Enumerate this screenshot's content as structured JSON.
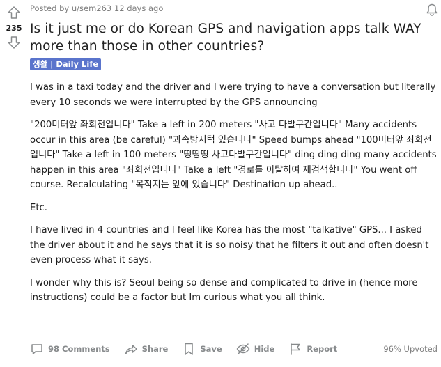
{
  "vote": {
    "count": "235"
  },
  "post": {
    "meta_prefix": "Posted by",
    "author": "u/sem263",
    "age": "12 days ago",
    "title": "Is it just me or do Korean GPS and navigation apps talk WAY more than those in other countries?",
    "flair": "생활 | Daily Life",
    "paragraphs": [
      "I was in a taxi today and the driver and I were trying to have a conversation but literally every 10 seconds we were interrupted by the GPS announcing",
      "\"200미터앞 좌회전입니다\" Take a left in 200 meters \"사고 다발구간입니다\" Many accidents occur in this area (be careful) \"과속방지턱 있습니다\" Speed bumps ahead \"100미터앞 좌회전입니다\" Take a left in 100 meters \"띵띵띵 사고다발구간입니다\" ding ding ding many accidents happen in this area \"좌회전입니다\" Take a left \"경로를 이탈하여 재검색합니다\" You went off course. Recalculating \"목적지는 앞에 있습니다\" Destination up ahead..",
      "Etc.",
      "I have lived in 4 countries and I feel like Korea has the most \"talkative\" GPS... I asked the driver about it and he says that it is so noisy that he filters it out and often doesn't even process what it says.",
      "I wonder why this is? Seoul being so dense and complicated to drive in (hence more instructions) could be a factor but Im curious what you all think."
    ]
  },
  "actions": {
    "comments": "98 Comments",
    "share": "Share",
    "save": "Save",
    "hide": "Hide",
    "report": "Report",
    "upvoted": "96% Upvoted"
  },
  "icons": {
    "upvote": "arrow-up-icon",
    "downvote": "arrow-down-icon",
    "notify": "bell-icon",
    "comments": "comment-icon",
    "share": "share-icon",
    "save": "bookmark-icon",
    "hide": "eye-slash-icon",
    "report": "flag-icon"
  },
  "colors": {
    "flair_bg": "#5a74cc",
    "muted": "#878a8c"
  }
}
